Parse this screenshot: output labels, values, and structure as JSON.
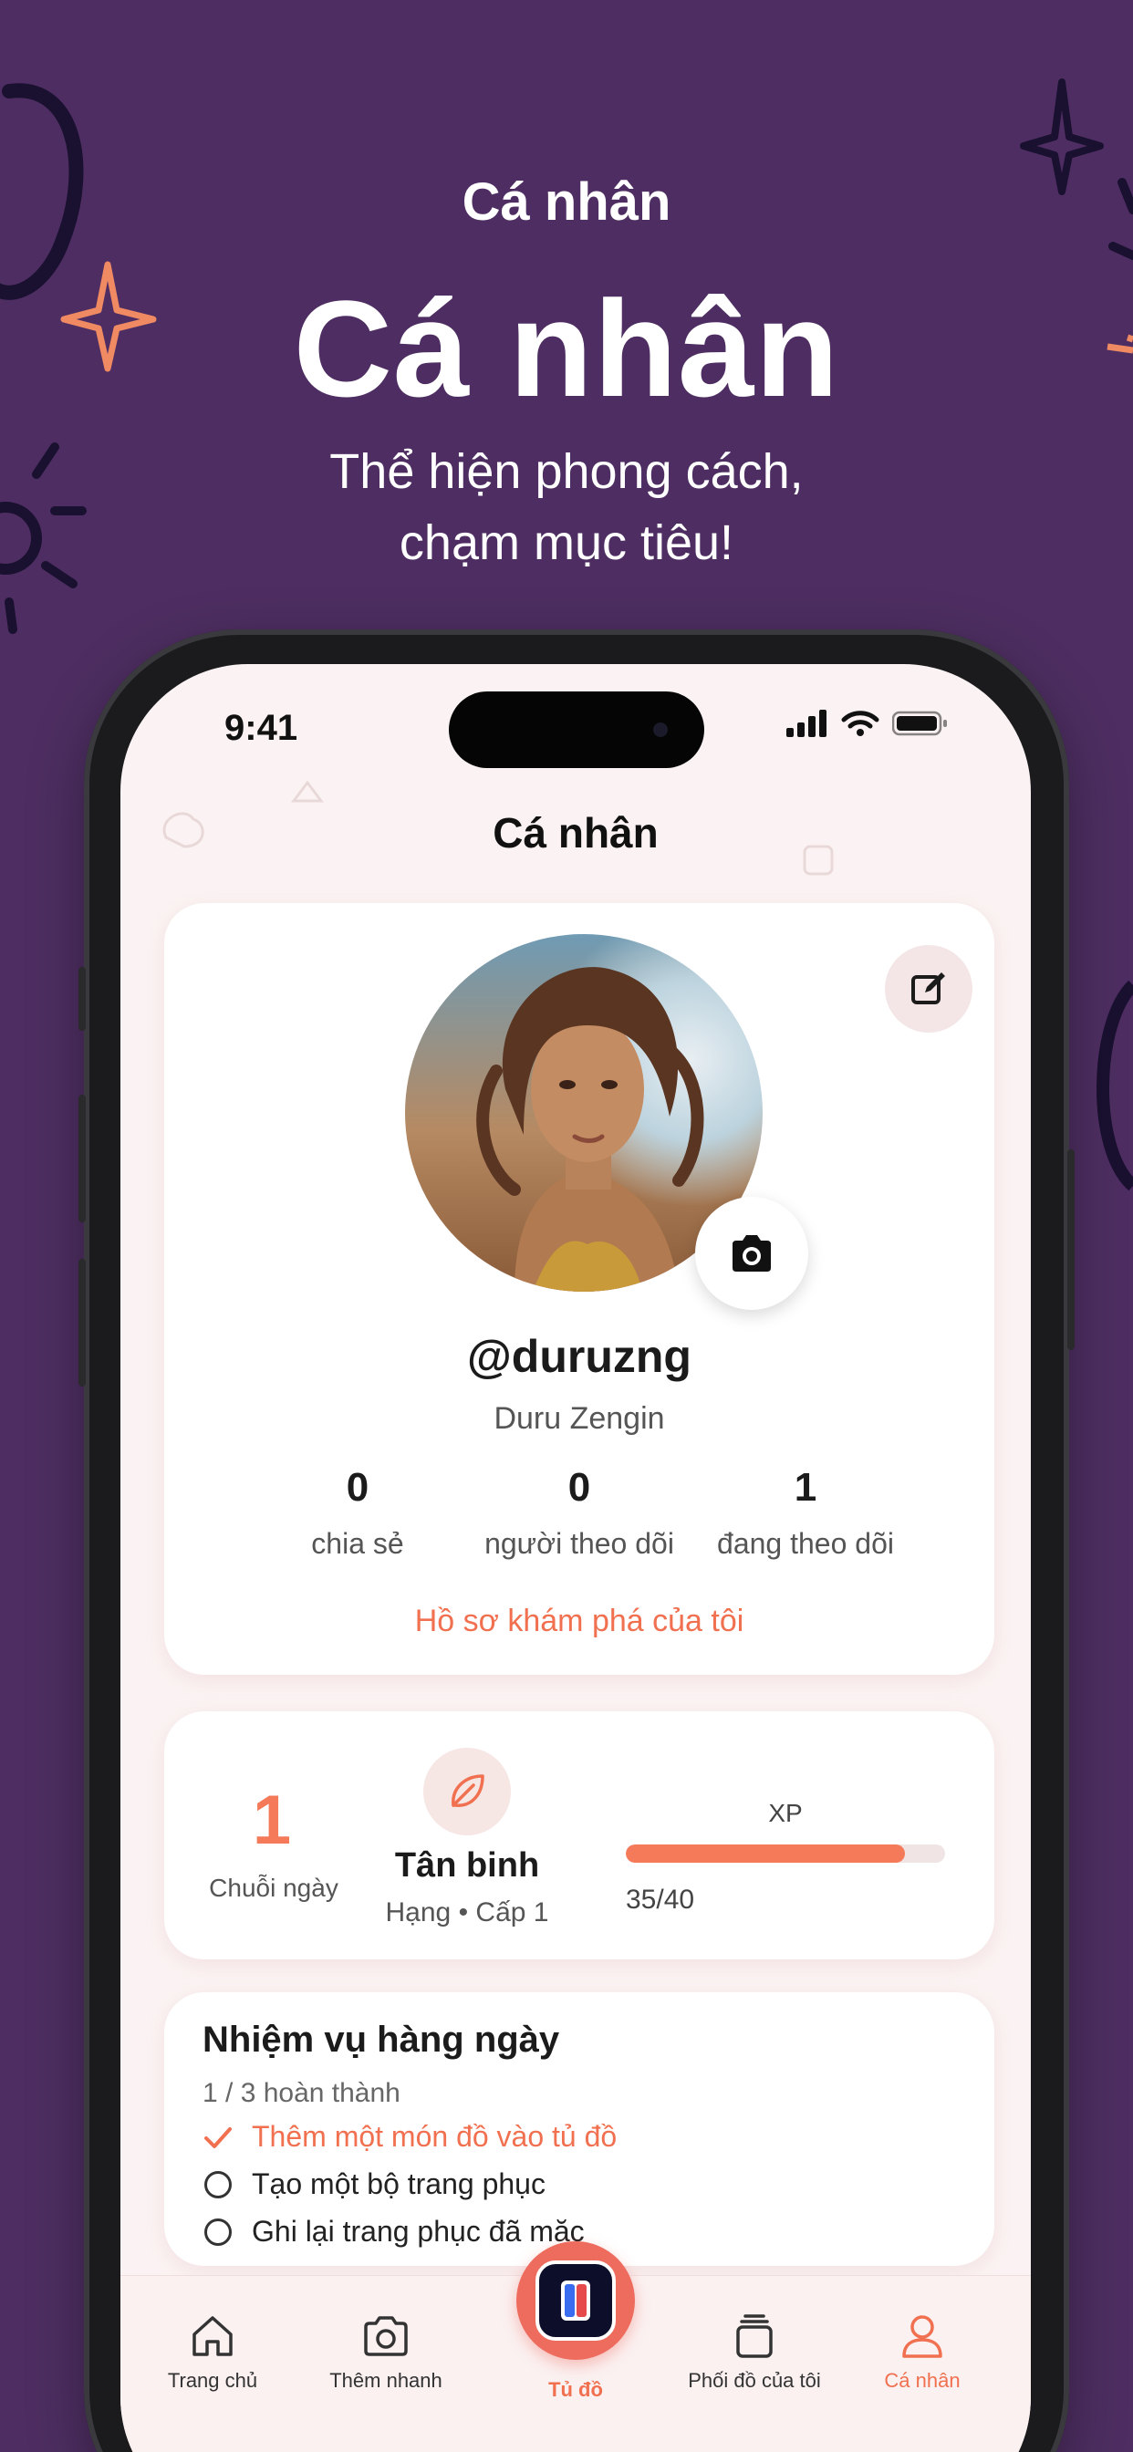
{
  "promo": {
    "kicker": "Cá nhân",
    "title": "Cá nhân",
    "subtitle_line1": "Thể hiện phong cách,",
    "subtitle_line2": "chạm mục tiêu!"
  },
  "status_bar": {
    "time": "9:41"
  },
  "header": {
    "title": "Cá nhân"
  },
  "profile": {
    "username": "@duruzng",
    "full_name": "Duru Zengin",
    "stats": [
      {
        "value": "0",
        "label": "chia sẻ"
      },
      {
        "value": "0",
        "label": "người theo dõi"
      },
      {
        "value": "1",
        "label": "đang theo dõi"
      }
    ],
    "discover_link": "Hồ sơ khám phá của tôi"
  },
  "level": {
    "streak_value": "1",
    "streak_label": "Chuỗi ngày",
    "rank_name": "Tân binh",
    "rank_sub": "Hạng • Cấp 1",
    "xp_label": "XP",
    "xp_text": "35/40",
    "xp_fraction": 0.875
  },
  "daily_quests": {
    "title": "Nhiệm vụ hàng ngày",
    "progress": "1 / 3 hoàn thành",
    "items": [
      {
        "label": "Thêm một món đồ vào tủ đồ",
        "done": true
      },
      {
        "label": "Tạo một bộ trang phục",
        "done": false
      },
      {
        "label": "Ghi lại trang phục đã mặc",
        "done": false
      }
    ]
  },
  "tabbar": {
    "tabs": [
      {
        "label": "Trang chủ",
        "icon": "home-icon"
      },
      {
        "label": "Thêm nhanh",
        "icon": "camera-icon"
      },
      {
        "label": "Tủ đồ",
        "icon": "wardrobe-icon"
      },
      {
        "label": "Phối đồ của tôi",
        "icon": "stack-icon"
      },
      {
        "label": "Cá nhân",
        "icon": "person-icon"
      }
    ]
  },
  "colors": {
    "background": "#4e2e62",
    "accent": "#f47a5a",
    "screen": "#fbf3f3"
  }
}
